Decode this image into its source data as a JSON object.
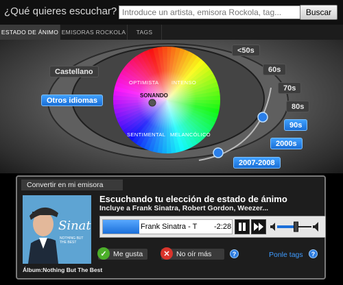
{
  "header": {
    "question": "¿Qué quieres escuchar?",
    "search_placeholder": "Introduce un artista, emisora Rockola, tag...",
    "search_button": "Buscar"
  },
  "tabs": [
    {
      "label": "ESTADO DE ÁNIMO",
      "active": true
    },
    {
      "label": "EMISORAS ROCKOLA",
      "active": false
    },
    {
      "label": "TAGS",
      "active": false
    }
  ],
  "languages": {
    "castellano": "Castellano",
    "otros": "Otros idiomas",
    "selected": "Otros idiomas"
  },
  "wheel": {
    "optimista": "OPTIMISTA",
    "intenso": "INTENSO",
    "sonando": "SONANDO",
    "sentimental": "SENTIMENTAL",
    "melancolico": "MELANCÓLICO"
  },
  "eras": [
    "<50s",
    "60s",
    "70s",
    "80s",
    "90s",
    "2000s",
    "2007-2008"
  ],
  "eras_selected": [
    "90s",
    "2000s",
    "2007-2008"
  ],
  "panel": {
    "convert_label": "Convertir en mi emisora",
    "title": "Escuchando tu elección de estado de ánimo",
    "subtitle": "Incluye a Frank Sinatra, Robert Gordon, Weezer...",
    "track": "Frank Sinatra - T",
    "time": "-2:28",
    "album": "Álbum:Nothing But The Best",
    "like": "Me gusta",
    "no_more": "No oír más",
    "tags_link": "Ponle tags",
    "help": "?",
    "cover_text": "Sinatra",
    "cover_subtext": "NOTHING BUT THE BEST"
  },
  "progress_fraction": 0.28,
  "volume_fraction": 0.55,
  "colors": {
    "accent_blue": "#1a6fd6",
    "link_blue": "#3e9bff",
    "like_green": "#4caf2a",
    "nomore_red": "#d9342b"
  }
}
